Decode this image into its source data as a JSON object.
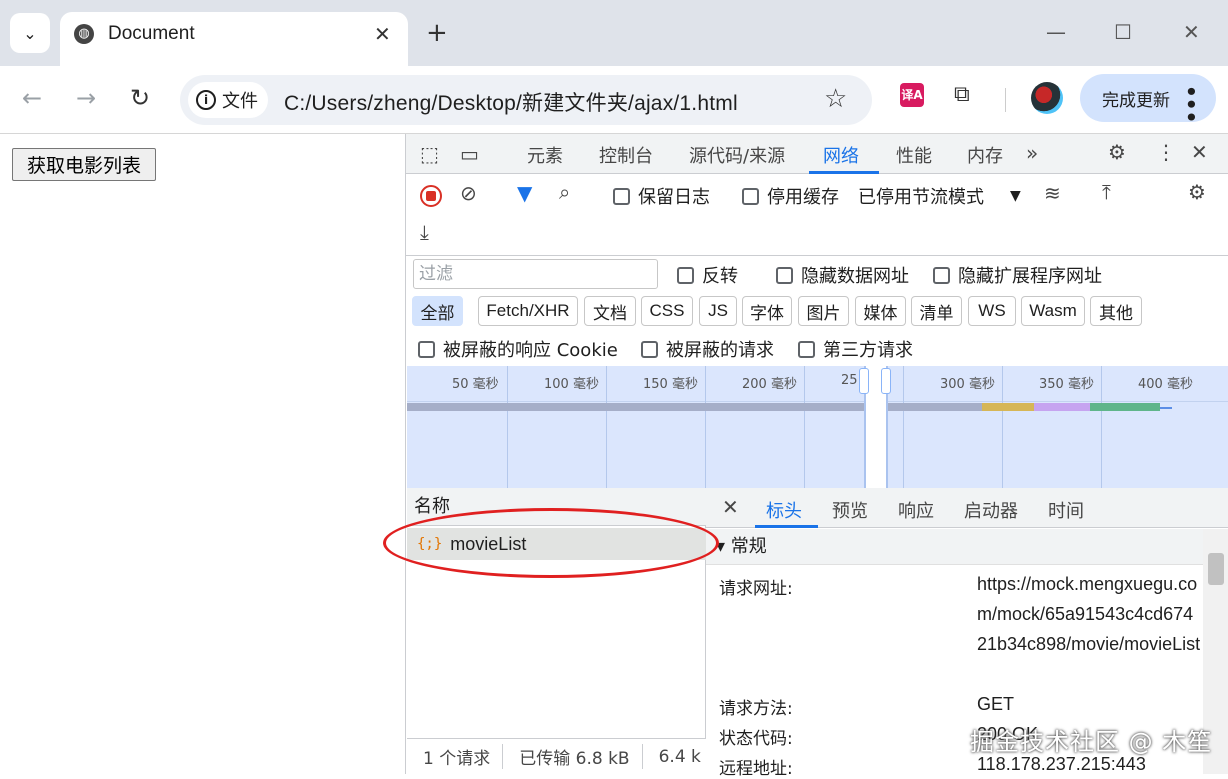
{
  "browser": {
    "tab_title": "Document",
    "url_chip": "文件",
    "url": "C:/Users/zheng/Desktop/新建文件夹/ajax/1.html",
    "update_label": "完成更新"
  },
  "page": {
    "button_label": "获取电影列表"
  },
  "devtools": {
    "tabs": [
      "元素",
      "控制台",
      "源代码/来源",
      "网络",
      "性能",
      "内存"
    ],
    "active_tab": "网络",
    "toolbar": {
      "preserve_log": "保留日志",
      "disable_cache": "停用缓存",
      "throttling": "已停用节流模式"
    },
    "filter": {
      "placeholder": "过滤",
      "invert": "反转",
      "hide_data_urls": "隐藏数据网址",
      "hide_extension_urls": "隐藏扩展程序网址"
    },
    "type_filters": [
      "全部",
      "Fetch/XHR",
      "文档",
      "CSS",
      "JS",
      "字体",
      "图片",
      "媒体",
      "清单",
      "WS",
      "Wasm",
      "其他"
    ],
    "blocked": {
      "blocked_cookies": "被屏蔽的响应 Cookie",
      "blocked_requests": "被屏蔽的请求",
      "third_party": "第三方请求"
    },
    "timeline_ticks": [
      "50 毫秒",
      "100 毫秒",
      "150 毫秒",
      "200 毫秒",
      "25",
      "300 毫秒",
      "350 毫秒",
      "400 毫秒"
    ],
    "requests": {
      "name_header": "名称",
      "items": [
        {
          "name": "movieList",
          "icon": "{;}"
        }
      ]
    },
    "status_bar": {
      "count": "1 个请求",
      "transferred": "已传输 6.8 kB",
      "resources": "6.4 k"
    },
    "detail": {
      "tabs": [
        "标头",
        "预览",
        "响应",
        "启动器",
        "时间"
      ],
      "active_tab": "标头",
      "section": "▾ 常规",
      "rows": [
        {
          "key": "请求网址:",
          "value": "https://mock.mengxuegu.com/mock/65a91543c4cd67421b34c898/movie/movieList"
        },
        {
          "key": "请求方法:",
          "value": "GET"
        },
        {
          "key": "状态代码:",
          "value": "200 OK"
        },
        {
          "key": "远程地址:",
          "value": "118.178.237.215:443"
        }
      ]
    }
  },
  "watermark": "掘金技术社区 @ 木笙",
  "colors": {
    "accent": "#1a73e8",
    "record": "#d93025",
    "annotation": "#e02020"
  }
}
